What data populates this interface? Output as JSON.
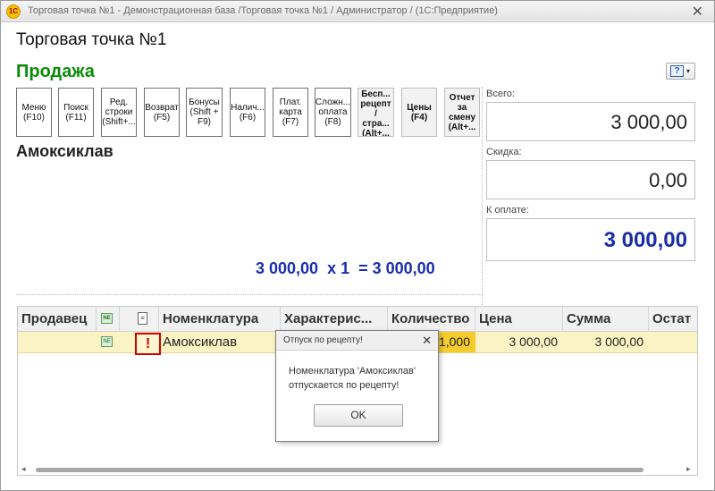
{
  "window": {
    "logo_text": "1С",
    "title": "Торговая точка №1 - Демонстрационная база /Торговая точка №1 / Администратор /  (1С:Предприятие)",
    "close_glyph": "✕"
  },
  "form": {
    "title": "Торговая точка №1",
    "section_title": "Продажа",
    "help_icon": "?",
    "help_arrow": "▾"
  },
  "function_buttons": [
    {
      "label": "Меню\n(F10)"
    },
    {
      "label": "Поиск\n(F11)"
    },
    {
      "label": "Ред.\nстроки\n(Shift+..."
    },
    {
      "label": "Возврат\n(F5)"
    },
    {
      "label": "Бонусы\n(Shift +\nF9)"
    },
    {
      "label": "Налич...\n(F6)"
    },
    {
      "label": "Плат.\nкарта\n(F7)"
    },
    {
      "label": "Сложн...\nоплата\n(F8)"
    },
    {
      "label": "Бесп...\nрецепт\n/\nстра...\n(Alt+..."
    },
    {
      "label": "Цены\n(F4)"
    },
    {
      "label": "Отчет\nза\nсмену\n(Alt+..."
    }
  ],
  "product": {
    "name": "Амоксиклав",
    "total_line": "3 000,00  x 1  = 3 000,00"
  },
  "summary": {
    "total_label": "Всего:",
    "total_value": "3 000,00",
    "discount_label": "Скидка:",
    "discount_value": "0,00",
    "to_pay_label": "К оплате:",
    "to_pay_value": "3 000,00"
  },
  "table": {
    "columns": {
      "seller": "Продавец",
      "nomenclature": "Номенклатура",
      "characteristic": "Характерис...",
      "quantity": "Количество",
      "price": "Цена",
      "sum": "Сумма",
      "remainder": "Остат"
    },
    "rows": [
      {
        "seller": "",
        "rx_mark": "!",
        "nomenclature": "Амоксиклав",
        "quantity": "1,000",
        "price": "3 000,00",
        "sum": "3 000,00"
      }
    ],
    "scroll_left": "◂",
    "scroll_right": "▸"
  },
  "dialog": {
    "title": "Отпуск по рецепту!",
    "close_glyph": "✕",
    "message": "Номенклатура 'Амоксиклав' отпускается по рецепту!",
    "ok_label": "OK"
  }
}
